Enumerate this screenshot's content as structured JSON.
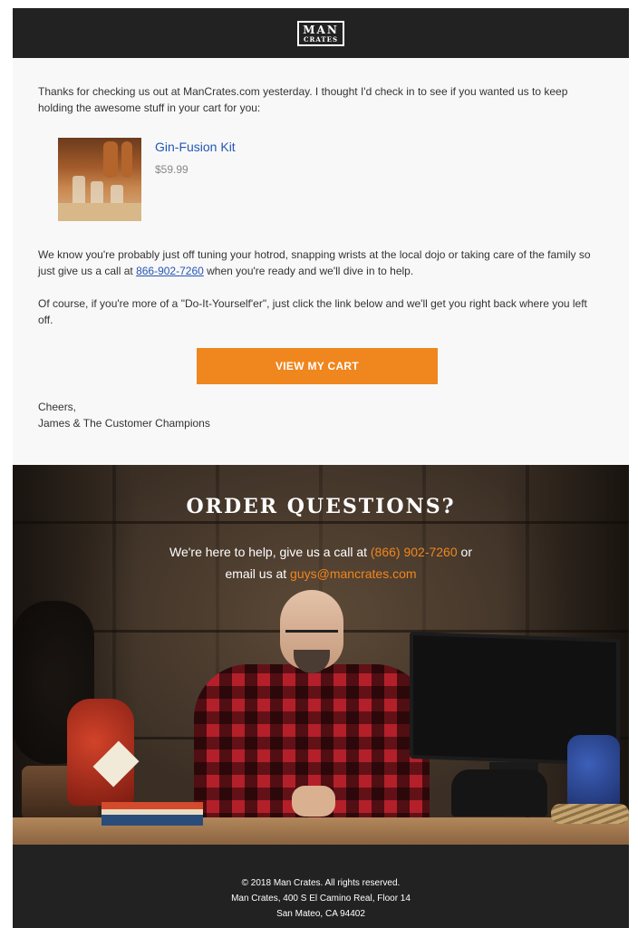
{
  "header": {
    "logo_line1": "MAN",
    "logo_line2": "CRATES"
  },
  "message": {
    "intro": "Thanks for checking us out at ManCrates.com yesterday. I thought I'd check in to see if you wanted us to keep holding the awesome stuff in your cart for you:",
    "product": {
      "name": "Gin-Fusion Kit",
      "price": "$59.99"
    },
    "para2_before": "We know you're probably just off tuning your hotrod, snapping wrists at the local dojo or taking care of the family so just give us a call at ",
    "para2_phone": "866-902-7260",
    "para2_after": " when you're ready and we'll dive in to help.",
    "para3": "Of course, if you're more of a \"Do-It-Yourself'er\", just click the link below and we'll get you right back where you left off.",
    "cta_label": "VIEW MY CART",
    "signoff_line1": "Cheers,",
    "signoff_line2": "James & The Customer Champions"
  },
  "hero": {
    "title": "ORDER QUESTIONS?",
    "line1_before": "We're here to help, give us a call at ",
    "phone": "(866) 902-7260",
    "line1_after": " or",
    "line2_before": "email us at ",
    "email": "guys@mancrates.com"
  },
  "footer": {
    "copyright": "© 2018 Man Crates. All rights reserved.",
    "address_line1": "Man Crates, 400 S El Camino Real, Floor 14",
    "address_line2": "San Mateo, CA 94402"
  },
  "colors": {
    "accent": "#f0861e",
    "link": "#2556b6",
    "dark": "#222222"
  }
}
